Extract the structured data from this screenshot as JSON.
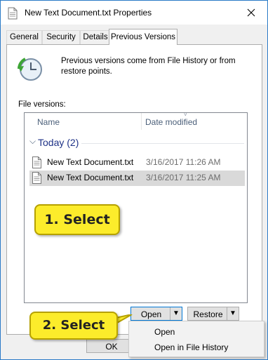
{
  "window": {
    "title": "New Text Document.txt Properties"
  },
  "tabs": [
    "General",
    "Security",
    "Details",
    "Previous Versions"
  ],
  "panel": {
    "info_text": "Previous versions come from File History or from restore points.",
    "versions_label": "File versions:"
  },
  "list": {
    "columns": [
      "Name",
      "Date modified"
    ],
    "group": "Today (2)",
    "rows": [
      {
        "name": "New Text Document.txt",
        "date": "3/16/2017 11:26 AM",
        "selected": false
      },
      {
        "name": "New Text Document.txt",
        "date": "3/16/2017 11:25 AM",
        "selected": true
      }
    ]
  },
  "buttons": {
    "open": "Open",
    "restore": "Restore",
    "ok": "OK"
  },
  "menu": {
    "items": [
      "Open",
      "Open in File History"
    ]
  },
  "callouts": {
    "step1": "1. Select",
    "step2": "2. Select"
  },
  "icons": [
    "document-icon",
    "close-icon",
    "file-history-icon",
    "chevron-icon",
    "dropdown-arrow-icon"
  ],
  "colors": {
    "accent": "#0078d7",
    "callout": "#fcec2b",
    "group_title": "#1e3287",
    "desktop": "#1f6fb5"
  }
}
